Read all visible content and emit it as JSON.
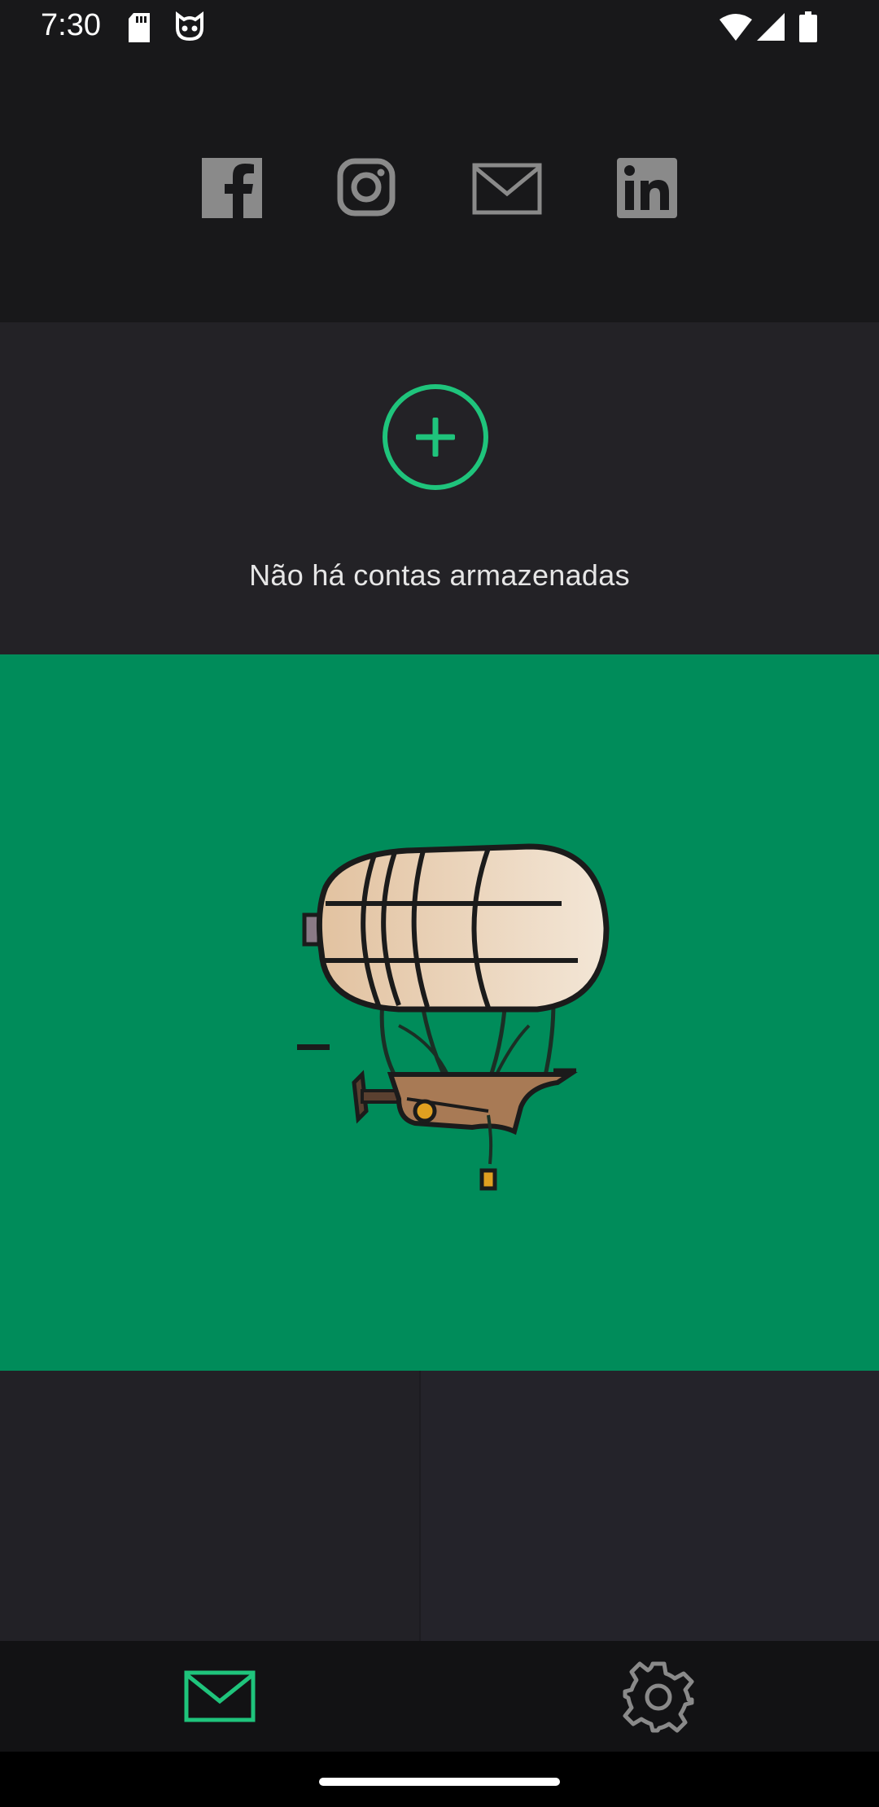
{
  "status_bar": {
    "time": "7:30",
    "left_icons": [
      "sd-card-icon",
      "cat-face-icon"
    ],
    "right_icons": [
      "wifi-icon",
      "cell-signal-icon",
      "battery-icon"
    ]
  },
  "header": {
    "social_icons": [
      "facebook-icon",
      "instagram-icon",
      "mail-icon",
      "linkedin-icon"
    ]
  },
  "accounts": {
    "add_icon": "add-circle-icon",
    "empty_message": "Não há contas armazenadas"
  },
  "banner": {
    "illustration": "airship-illustration",
    "color": "#008c5a"
  },
  "bottom_nav": {
    "items": [
      {
        "icon": "mail-icon",
        "active": true
      },
      {
        "icon": "gear-icon",
        "active": false
      }
    ],
    "active_color": "#1fc47c"
  },
  "colors": {
    "accent": "#1fc47c",
    "banner": "#008c5a",
    "icon_gray": "#8a8a8a"
  }
}
